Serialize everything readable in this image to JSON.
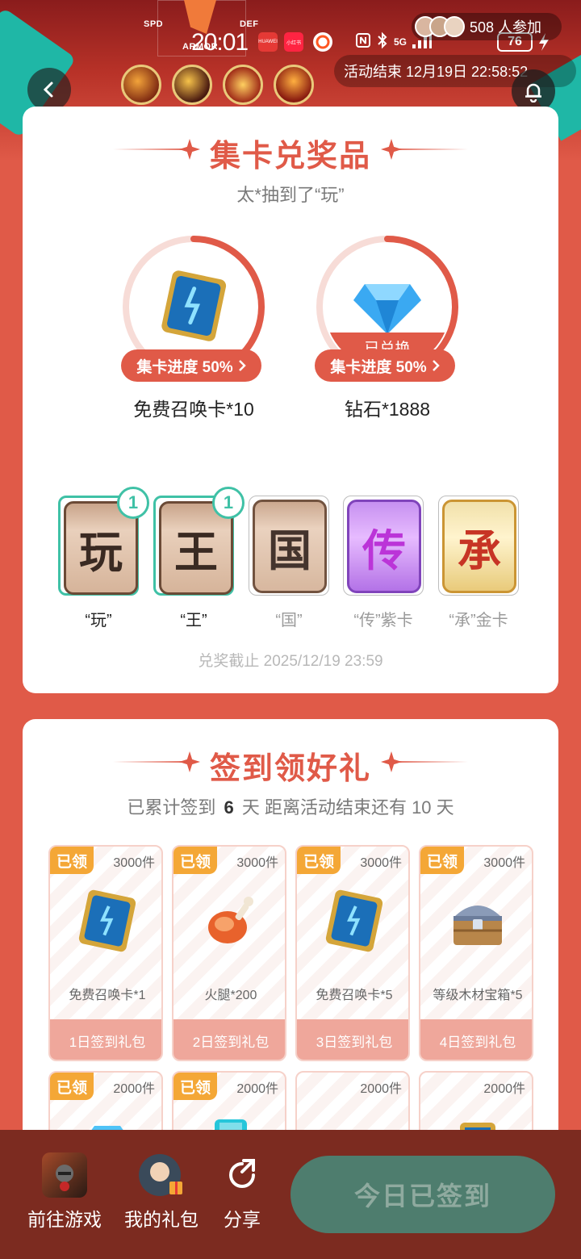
{
  "status_bar": {
    "time": "20:01",
    "battery": "76",
    "network": "5G",
    "app_icons": [
      {
        "name": "huawei-icon",
        "label": "HUAWEI",
        "color": "#e53935"
      },
      {
        "name": "xiaohongshu-icon",
        "label": "小红书",
        "color": "#ff2442"
      },
      {
        "name": "browser-icon",
        "label": "",
        "color": "#ff5722"
      }
    ]
  },
  "banner": {
    "stats": [
      "SPD",
      "DEF",
      "ARMOR"
    ],
    "participants": "508 人参加",
    "end_time": "活动结束 12月19日 22:58:52"
  },
  "collect": {
    "title": "集卡兑奖品",
    "ticker": "太*抽到了“玩”",
    "prizes": [
      {
        "name": "免费召唤卡*10",
        "progress_label": "集卡进度 50%",
        "progress": 0.5,
        "redeemed": ""
      },
      {
        "name": "钻石*1888",
        "progress_label": "集卡进度 50%",
        "progress": 0.5,
        "redeemed": "已兑换"
      }
    ],
    "cards": [
      {
        "char": "玩",
        "label": "“玩”",
        "count": "1",
        "owned": true,
        "style": "normal"
      },
      {
        "char": "王",
        "label": "“王”",
        "count": "1",
        "owned": true,
        "style": "normal"
      },
      {
        "char": "国",
        "label": "“国”",
        "count": "",
        "owned": false,
        "style": "normal"
      },
      {
        "char": "传",
        "label": "“传”紫卡",
        "count": "",
        "owned": false,
        "style": "purple"
      },
      {
        "char": "承",
        "label": "“承”金卡",
        "count": "",
        "owned": false,
        "style": "gold"
      }
    ],
    "deadline": "兑奖截止 2025/12/19 23:59"
  },
  "checkin": {
    "title": "签到领好礼",
    "summary_pre": "已累计签到",
    "days": "6",
    "summary_mid": "天  距离活动结束还有 10 天",
    "claimed_label": "已领",
    "gifts": [
      {
        "stock": "3000件",
        "name": "免费召唤卡*1",
        "day": "1日签到礼包",
        "icon": "summon-card-icon"
      },
      {
        "stock": "3000件",
        "name": "火腿*200",
        "day": "2日签到礼包",
        "icon": "ham-icon"
      },
      {
        "stock": "3000件",
        "name": "免费召唤卡*5",
        "day": "3日签到礼包",
        "icon": "summon-card-icon"
      },
      {
        "stock": "3000件",
        "name": "等级木材宝箱*5",
        "day": "4日签到礼包",
        "icon": "treasure-chest-icon"
      }
    ],
    "gifts_row2": [
      {
        "stock": "2000件",
        "claimed": true
      },
      {
        "stock": "2000件",
        "claimed": true
      },
      {
        "stock": "2000件",
        "claimed": false
      },
      {
        "stock": "2000件",
        "claimed": false
      }
    ]
  },
  "bottom_nav": {
    "go_game": "前往游戏",
    "my_gifts": "我的礼包",
    "share": "分享",
    "checked_in": "今日已签到"
  },
  "colors": {
    "primary": "#e05a48",
    "teal": "#3fc1a6",
    "claimed_badge": "#f4a736",
    "bottom_bar": "#7c2b20",
    "checked_button": "#4e7d6e"
  }
}
